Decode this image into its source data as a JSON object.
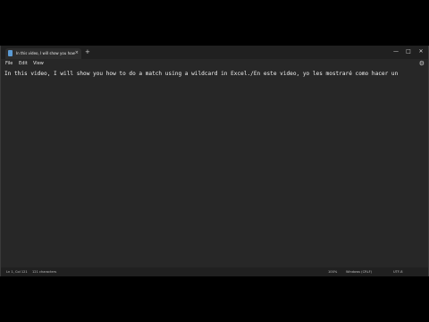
{
  "window": {
    "tab_title": "In this video, I will show you how",
    "tab_close": "×",
    "new_tab": "+",
    "minimize": "—",
    "maximize": "□",
    "close": "✕"
  },
  "menu": {
    "items": [
      "File",
      "Edit",
      "View"
    ],
    "settings_icon": "gear-icon",
    "settings_glyph": "⚙"
  },
  "editor": {
    "text": "In this video, I will show you how to do a match using a wildcard in Excel./En este video, yo les mostraré como hacer un"
  },
  "status": {
    "position": "Ln 1, Col 121",
    "characters": "121 characters",
    "zoom": "100%",
    "line_ending": "Windows (CRLF)",
    "encoding": "UTF-8"
  }
}
